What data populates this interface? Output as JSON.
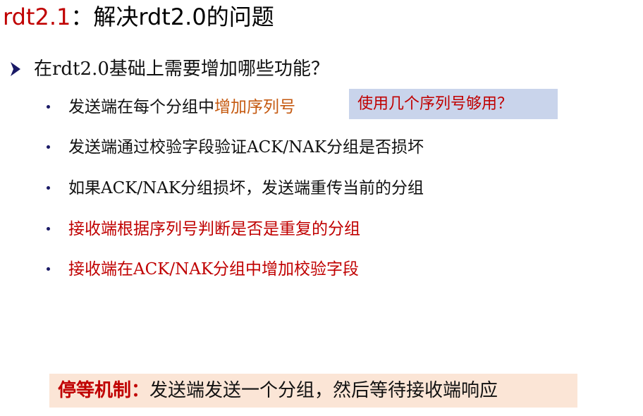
{
  "title": {
    "prefix": "rdt2.1",
    "rest": "：解决rdt2.0的问题"
  },
  "main_bullet": {
    "text": "在rdt2.0基础上需要增加哪些功能？"
  },
  "items": [
    {
      "text": "发送端在每个分组中",
      "highlight": "增加序列号"
    },
    {
      "text": "发送端通过校验字段验证ACK/NAK分组是否损坏"
    },
    {
      "text": "如果ACK/NAK分组损坏，发送端重传当前的分组"
    },
    {
      "text": "接收端根据序列号判断是否是重复的分组"
    },
    {
      "text": "接收端在ACK/NAK分组中增加校验字段"
    }
  ],
  "callout": {
    "text": "使用几个序列号够用？"
  },
  "footer": {
    "label": "停等机制：",
    "text": "发送端发送一个分组，然后等待接收端响应"
  },
  "colors": {
    "accent_red": "#c00000",
    "accent_orange": "#c55a11",
    "callout_bg": "#c9d4eb",
    "footer_bg": "#fbe5d6",
    "bullet_blue": "#1a1a66"
  },
  "icons": {
    "main_bullet": "arrowhead-bullet-icon",
    "sub_bullet": "dot-bullet-icon"
  }
}
